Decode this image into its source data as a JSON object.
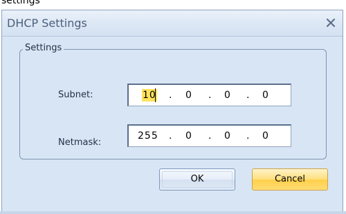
{
  "top_label": "settings",
  "dialog": {
    "title": "DHCP Settings",
    "close_glyph": "x",
    "group_label": "Settings",
    "subnet": {
      "label": "Subnet:",
      "octets": [
        "10",
        "0",
        "0",
        "0"
      ],
      "selected_octet_index": 0
    },
    "netmask": {
      "label": "Netmask:",
      "octets": [
        "255",
        "0",
        "0",
        "0"
      ]
    },
    "separator": ".",
    "ok_label": "OK",
    "cancel_label": "Cancel"
  },
  "colors": {
    "dialog_bg": "#d8e5f4",
    "title_text": "#4b5f7b",
    "selection": "#ffe25c",
    "cancel_button": "#ffd04a"
  },
  "icons": {
    "close": "close-icon"
  }
}
